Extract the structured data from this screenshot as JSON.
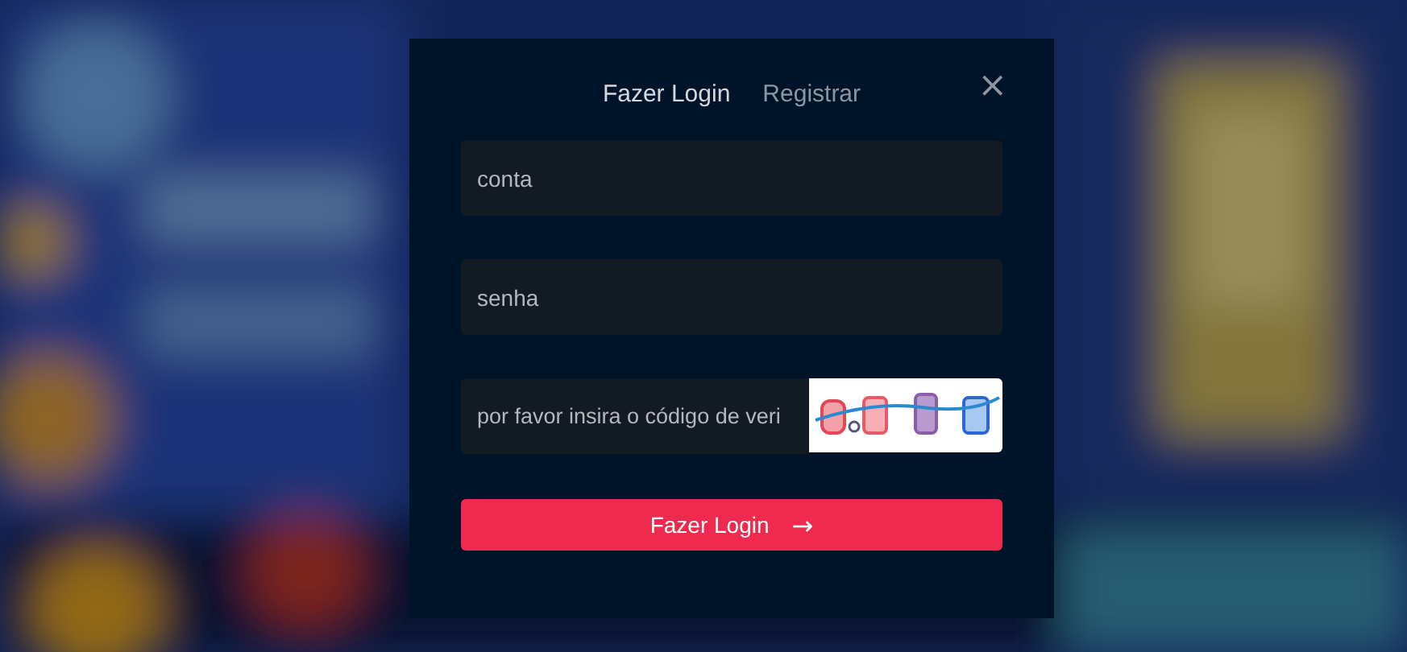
{
  "dialog": {
    "tabs": [
      {
        "label": "Fazer Login",
        "selected": true
      },
      {
        "label": "Registrar",
        "selected": false
      }
    ],
    "close": "×",
    "fields": [
      {
        "kind": "text",
        "placeholder": "conta"
      },
      {
        "kind": "password",
        "placeholder": "senha"
      },
      {
        "kind": "captcha",
        "placeholder": "por favor insira o código de veri"
      }
    ],
    "submit": {
      "label": "Fazer Login",
      "icon": "→"
    }
  }
}
